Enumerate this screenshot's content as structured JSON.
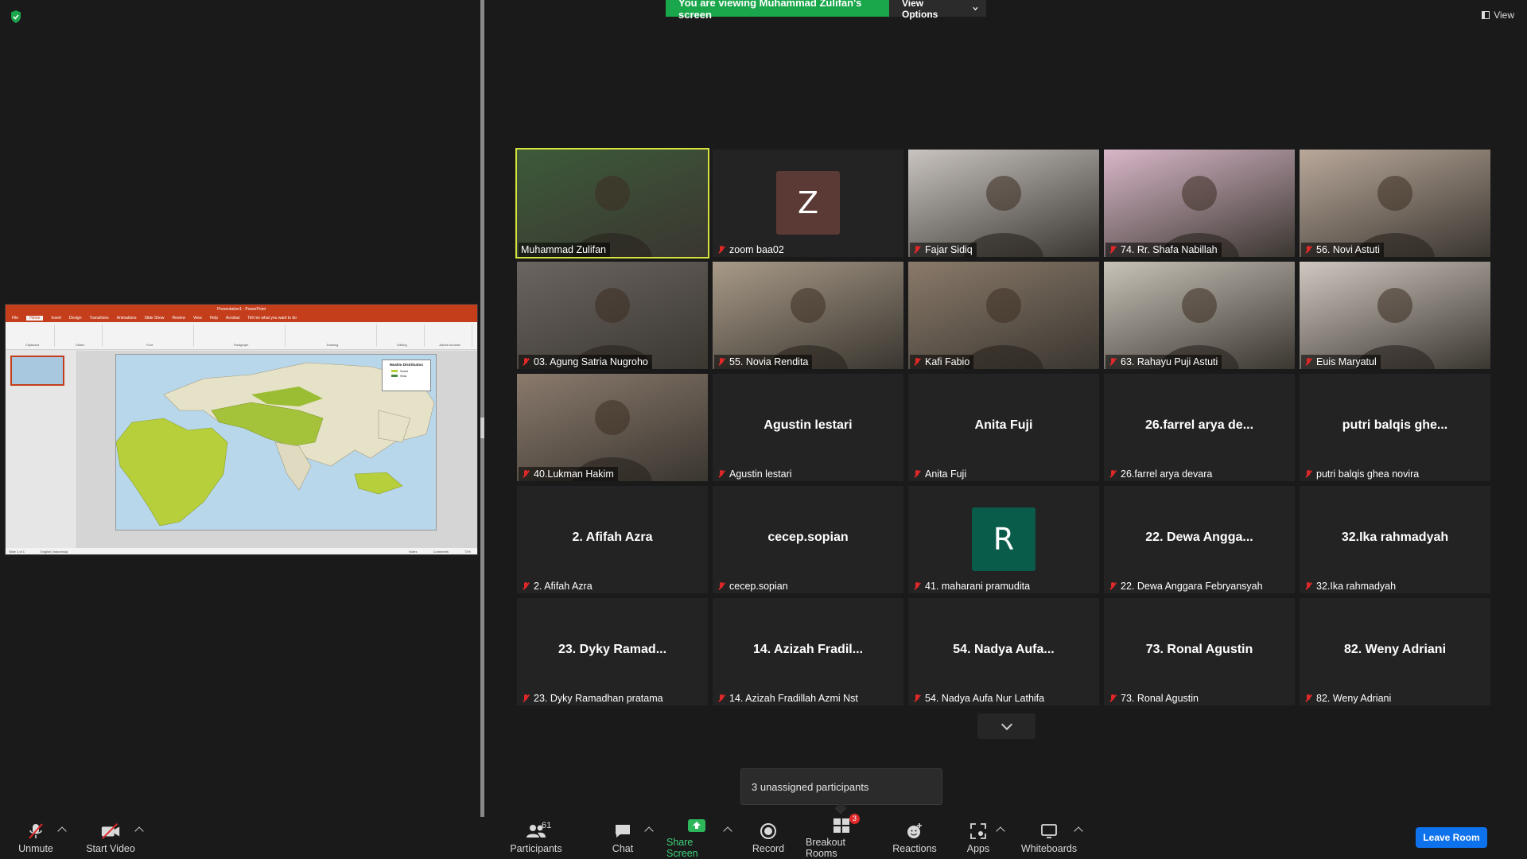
{
  "banner": {
    "message": "You are viewing Muhammad Zulifan's screen",
    "view_options": "View Options"
  },
  "view_button": "View",
  "shared_screen": {
    "app_title": "Presentation1 - PowerPoint",
    "tabs": [
      "File",
      "Home",
      "Insert",
      "Design",
      "Transitions",
      "Animations",
      "Slide Show",
      "Review",
      "View",
      "Help",
      "Acrobat",
      "Tell me what you want to do"
    ],
    "ribbon_groups": [
      "Clipboard",
      "Slides",
      "Font",
      "Paragraph",
      "Drawing",
      "Editing",
      "Adobe Acrobat"
    ],
    "slide_legend_title": "Muslim Distribution",
    "slide_legend_items": [
      "Sunni",
      "Shia"
    ],
    "status": [
      "Slide 1 of 1",
      "English (Indonesia)",
      "Notes",
      "Comments",
      "72%"
    ]
  },
  "participants_tiles": [
    {
      "name": "Muhammad Zulifan",
      "muted": false,
      "video": true,
      "active": true,
      "bg": "#3d5a3a"
    },
    {
      "name": "zoom baa02",
      "muted": true,
      "avatar": "Z",
      "avatar_color": "#5b3a35"
    },
    {
      "name": "Fajar Sidiq",
      "muted": true,
      "video": true,
      "bg": "#c9c4c0"
    },
    {
      "name": "74. Rr. Shafa Nabillah",
      "muted": true,
      "video": true,
      "bg": "#d8b7c8"
    },
    {
      "name": "56. Novi Astuti",
      "muted": true,
      "video": true,
      "bg": "#b9a89a"
    },
    {
      "name": "03. Agung Satria Nugroho",
      "muted": true,
      "video": true,
      "bg": "#6b6560"
    },
    {
      "name": "55. Novia Rendita",
      "muted": true,
      "video": true,
      "bg": "#a89a88"
    },
    {
      "name": "Kafi Fabio",
      "muted": true,
      "video": true,
      "bg": "#8a7a6a"
    },
    {
      "name": "63. Rahayu Puji Astuti",
      "muted": true,
      "video": true,
      "bg": "#c8c2b8"
    },
    {
      "name": "Euis Maryatul",
      "muted": true,
      "video": true,
      "bg": "#d0c8c0"
    },
    {
      "name": "40.Lukman Hakim",
      "muted": true,
      "video": true,
      "bg": "#8a7a6c"
    },
    {
      "name": "Agustin lestari",
      "muted": true,
      "center": "Agustin lestari"
    },
    {
      "name": "Anita Fuji",
      "muted": true,
      "center": "Anita Fuji"
    },
    {
      "name": "26.farrel arya devara",
      "muted": true,
      "center": "26.farrel arya de..."
    },
    {
      "name": "putri balqis ghea novira",
      "muted": true,
      "center": "putri balqis ghe..."
    },
    {
      "name": "2. Afifah Azra",
      "muted": true,
      "center": "2. Afifah Azra"
    },
    {
      "name": "cecep.sopian",
      "muted": true,
      "center": "cecep.sopian"
    },
    {
      "name": "41. maharani pramudita",
      "muted": true,
      "avatar": "R",
      "avatar_color": "#0a5c4a"
    },
    {
      "name": "22. Dewa Anggara Febryansyah",
      "muted": true,
      "center": "22. Dewa Angga..."
    },
    {
      "name": "32.Ika rahmadyah",
      "muted": true,
      "center": "32.Ika rahmadyah"
    },
    {
      "name": "23. Dyky Ramadhan pratama",
      "muted": true,
      "center": "23. Dyky Ramad..."
    },
    {
      "name": "14. Azizah Fradillah Azmi Nst",
      "muted": true,
      "center": "14. Azizah Fradil..."
    },
    {
      "name": "54. Nadya Aufa Nur Lathifa",
      "muted": true,
      "center": "54. Nadya Aufa..."
    },
    {
      "name": "73. Ronal Agustin",
      "muted": true,
      "center": "73. Ronal Agustin"
    },
    {
      "name": "82. Weny Adriani",
      "muted": true,
      "center": "82. Weny Adriani"
    }
  ],
  "tooltip": "3 unassigned participants",
  "toolbar": {
    "unmute": "Unmute",
    "start_video": "Start Video",
    "participants": "Participants",
    "participants_count": "61",
    "chat": "Chat",
    "share_screen": "Share Screen",
    "record": "Record",
    "breakout_rooms": "Breakout Rooms",
    "breakout_count": "3",
    "reactions": "Reactions",
    "apps": "Apps",
    "whiteboards": "Whiteboards",
    "leave_room": "Leave Room"
  },
  "colors": {
    "accent_green": "#1aa64b",
    "leave_blue": "#0e72ed",
    "active_speaker": "#d6e33d",
    "muted_red": "#e02828"
  }
}
